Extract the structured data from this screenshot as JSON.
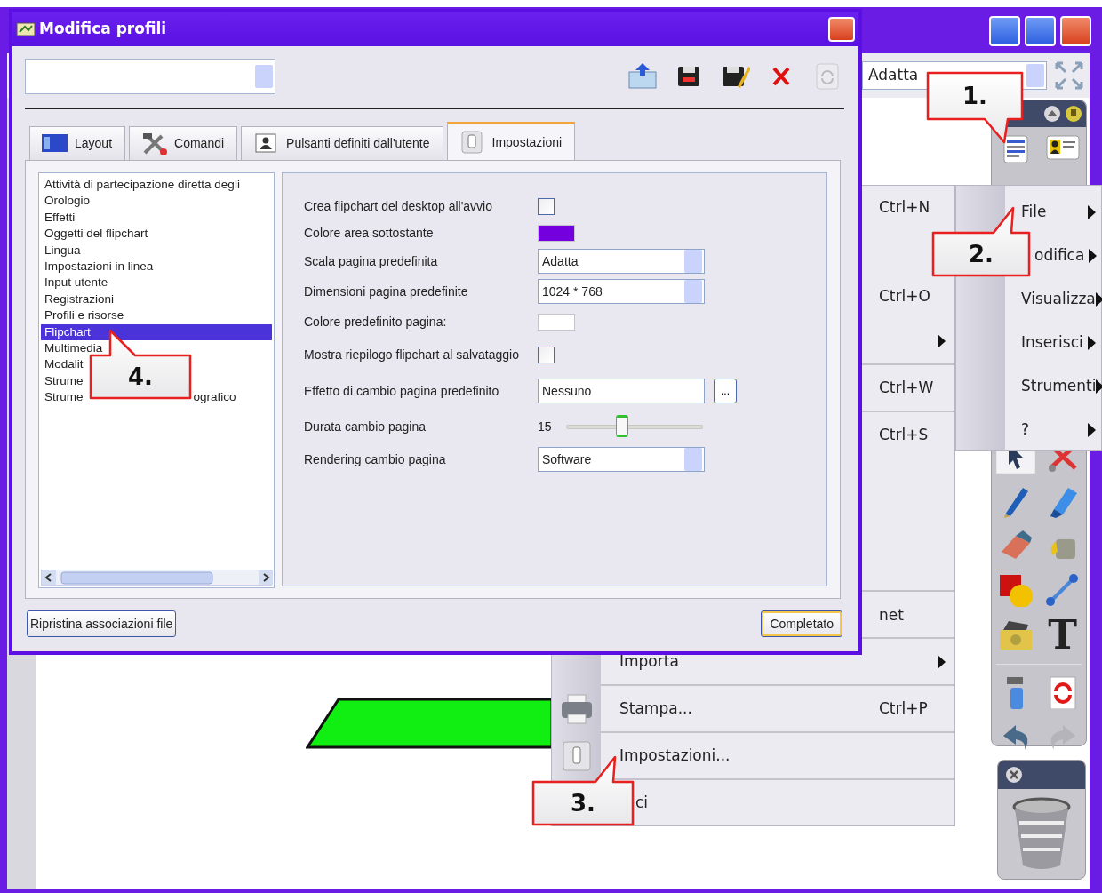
{
  "app": {
    "zoom_value": "Adatta",
    "text_tool": "T"
  },
  "file_menu": [
    {
      "kind": "item",
      "shortcut": "Ctrl+N",
      "has_submenu": false
    },
    {
      "kind": "item"
    },
    {
      "kind": "item",
      "shortcut": "Ctrl+O",
      "has_submenu": false
    },
    {
      "kind": "item",
      "has_submenu": true
    },
    {
      "kind": "separator"
    },
    {
      "kind": "item",
      "shortcut": "Ctrl+W",
      "has_submenu": false
    },
    {
      "kind": "separator"
    },
    {
      "kind": "item",
      "shortcut": "Ctrl+S",
      "has_submenu": false
    },
    {
      "kind": "item",
      "has_submenu": false
    },
    {
      "kind": "item",
      "has_submenu": false
    },
    {
      "kind": "item",
      "has_submenu": false
    },
    {
      "kind": "separator"
    },
    {
      "kind": "cut_right",
      "label": "net",
      "has_submenu": false
    },
    {
      "kind": "separator"
    },
    {
      "kind": "item",
      "label": "Importa",
      "has_submenu": true
    },
    {
      "kind": "separator"
    },
    {
      "kind": "printer",
      "label": "Stampa...",
      "shortcut": "Ctrl+P",
      "has_submenu": false
    },
    {
      "kind": "separator"
    },
    {
      "kind": "settings",
      "label": "Impostazioni...",
      "has_submenu": false
    },
    {
      "kind": "separator"
    },
    {
      "kind": "cut_left",
      "label": "ci",
      "has_submenu": false
    }
  ],
  "menu_bar": [
    {
      "kind": "item",
      "label": "File",
      "has_submenu": true
    },
    {
      "kind": "cut_left",
      "label": "odifica",
      "has_submenu": true
    },
    {
      "kind": "item",
      "label": "Visualizza",
      "has_submenu": true
    },
    {
      "kind": "item",
      "label": "Inserisci",
      "has_submenu": true
    },
    {
      "kind": "item",
      "label": "Strumenti",
      "has_submenu": true
    },
    {
      "kind": "item",
      "label": "?",
      "has_submenu": true
    }
  ],
  "dialog": {
    "title": "Modifica profili",
    "toolbar": [
      {
        "kind": "import",
        "disabled": false
      },
      {
        "kind": "save",
        "disabled": false
      },
      {
        "kind": "save_edit",
        "disabled": false
      },
      {
        "kind": "delete",
        "disabled": false
      },
      {
        "kind": "refresh",
        "disabled": true
      }
    ],
    "tabs": [
      {
        "label": "Layout",
        "kind": "layout",
        "selected": false
      },
      {
        "label": "Comandi",
        "kind": "tools",
        "selected": false
      },
      {
        "label": "Pulsanti definiti dall'utente",
        "kind": "user",
        "selected": false
      },
      {
        "label": "Impostazioni",
        "kind": "switch",
        "selected": true
      }
    ],
    "categories": [
      {
        "label": "Attività di partecipazione diretta degli",
        "selected": false
      },
      {
        "label": "Orologio",
        "selected": false
      },
      {
        "label": "Effetti",
        "selected": false
      },
      {
        "label": "Oggetti del flipchart",
        "selected": false
      },
      {
        "label": "Lingua",
        "selected": false
      },
      {
        "label": "Impostazioni in linea",
        "selected": false
      },
      {
        "label": "Input utente",
        "selected": false
      },
      {
        "label": "Registrazioni",
        "selected": false
      },
      {
        "label": "Profili e risorse",
        "selected": false
      },
      {
        "label": "Flipchart",
        "selected": true
      },
      {
        "label": "Multimedia",
        "selected": false
      },
      {
        "label": "Modalit",
        "selected": false
      },
      {
        "label": "Strume",
        "selected": false
      },
      {
        "label": "Strume",
        "tail": "ografico",
        "selected": false
      }
    ],
    "settings": [
      {
        "kind": "checkbox",
        "label": "Crea flipchart del desktop all'avvio",
        "checked": false
      },
      {
        "kind": "color",
        "label": "Colore area sottostante",
        "color": "#7400e0"
      },
      {
        "kind": "select",
        "label": "Scala pagina predefinita",
        "value": "Adatta"
      },
      {
        "kind": "select",
        "label": "Dimensioni pagina predefinite",
        "value": "1024 * 768"
      },
      {
        "kind": "color",
        "label": "Colore predefinito pagina:",
        "color": "#ffffff"
      },
      {
        "kind": "checkbox",
        "label": "Mostra riepilogo flipchart al salvataggio",
        "checked": false
      },
      {
        "kind": "text_button",
        "label": "Effetto di cambio pagina predefinito",
        "value": "Nessuno",
        "button_label": "..."
      },
      {
        "kind": "slider",
        "label": "Durata cambio pagina",
        "reading": "15",
        "level": 0.41
      },
      {
        "kind": "select",
        "label": "Rendering cambio pagina",
        "value": "Software"
      }
    ],
    "buttons": [
      {
        "label": "Ripristina associazioni file",
        "default": false
      },
      {
        "label": "Completato",
        "default": true
      }
    ]
  },
  "callouts": [
    {
      "label": "1."
    },
    {
      "label": "2."
    },
    {
      "label": "3."
    },
    {
      "label": "4."
    }
  ]
}
